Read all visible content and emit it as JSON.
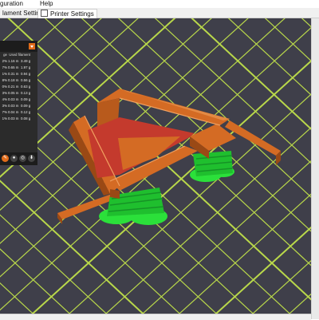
{
  "menubar": {
    "item_configuration": "guration",
    "item_help": "Help"
  },
  "tabs": [
    {
      "label": "lament Settings"
    },
    {
      "label": "Printer Settings"
    }
  ],
  "sidebar": {
    "columns": [
      "ge",
      "Used filament"
    ],
    "rows": [
      {
        "a": "2%",
        "b": "1.16 m",
        "c": "3.49 g"
      },
      {
        "a": "7%",
        "b": "0.65 m",
        "c": "1.97 g"
      },
      {
        "a": "1%",
        "b": "0.31 m",
        "c": "0.94 g"
      },
      {
        "a": "8%",
        "b": "0.18 m",
        "c": "0.56 g"
      },
      {
        "a": "0%",
        "b": "0.21 m",
        "c": "0.63 g"
      },
      {
        "a": "3%",
        "b": "0.05 m",
        "c": "0.13 g"
      },
      {
        "a": "4%",
        "b": "0.03 m",
        "c": "0.09 g"
      },
      {
        "a": "3%",
        "b": "0.03 m",
        "c": "0.09 g"
      },
      {
        "a": "7%",
        "b": "0.04 m",
        "c": "0.12 g"
      },
      {
        "a": "1%",
        "b": "0.03 m",
        "c": "0.08 g"
      }
    ],
    "tool_icons": [
      "edit-icon",
      "drops-icon",
      "shield-icon",
      "download-icon"
    ]
  },
  "colors": {
    "bed": "#3f3f4a",
    "grid": "#b9d84a",
    "part": "#d46b24",
    "part_dark": "#9a4915",
    "infill": "#c43a2d",
    "support": "#2be03a",
    "support_dark": "#169326"
  }
}
